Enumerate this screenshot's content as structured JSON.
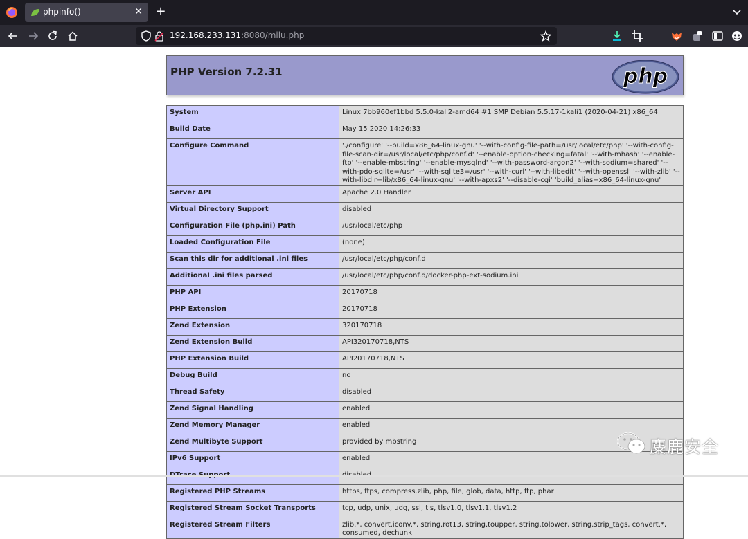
{
  "browser": {
    "tab_title": "phpinfo()",
    "tab_close": "✕",
    "new_tab": "+",
    "url_host": "192.168.233.131",
    "url_rest": ":8080/milu.php"
  },
  "page": {
    "heading": "PHP Version 7.2.31",
    "logo_text": "php",
    "rows": [
      {
        "k": "System",
        "v": "Linux 7bb960ef1bbd 5.5.0-kali2-amd64 #1 SMP Debian 5.5.17-1kali1 (2020-04-21) x86_64"
      },
      {
        "k": "Build Date",
        "v": "May 15 2020 14:26:33"
      },
      {
        "k": "Configure Command",
        "v": "'./configure' '--build=x86_64-linux-gnu' '--with-config-file-path=/usr/local/etc/php' '--with-config-file-scan-dir=/usr/local/etc/php/conf.d' '--enable-option-checking=fatal' '--with-mhash' '--enable-ftp' '--enable-mbstring' '--enable-mysqlnd' '--with-password-argon2' '--with-sodium=shared' '--with-pdo-sqlite=/usr' '--with-sqlite3=/usr' '--with-curl' '--with-libedit' '--with-openssl' '--with-zlib' '--with-libdir=lib/x86_64-linux-gnu' '--with-apxs2' '--disable-cgi' 'build_alias=x86_64-linux-gnu'"
      },
      {
        "k": "Server API",
        "v": "Apache 2.0 Handler"
      },
      {
        "k": "Virtual Directory Support",
        "v": "disabled"
      },
      {
        "k": "Configuration File (php.ini) Path",
        "v": "/usr/local/etc/php"
      },
      {
        "k": "Loaded Configuration File",
        "v": "(none)"
      },
      {
        "k": "Scan this dir for additional .ini files",
        "v": "/usr/local/etc/php/conf.d"
      },
      {
        "k": "Additional .ini files parsed",
        "v": "/usr/local/etc/php/conf.d/docker-php-ext-sodium.ini"
      },
      {
        "k": "PHP API",
        "v": "20170718"
      },
      {
        "k": "PHP Extension",
        "v": "20170718"
      },
      {
        "k": "Zend Extension",
        "v": "320170718"
      },
      {
        "k": "Zend Extension Build",
        "v": "API320170718,NTS"
      },
      {
        "k": "PHP Extension Build",
        "v": "API20170718,NTS"
      },
      {
        "k": "Debug Build",
        "v": "no"
      },
      {
        "k": "Thread Safety",
        "v": "disabled"
      },
      {
        "k": "Zend Signal Handling",
        "v": "enabled"
      },
      {
        "k": "Zend Memory Manager",
        "v": "enabled"
      },
      {
        "k": "Zend Multibyte Support",
        "v": "provided by mbstring"
      },
      {
        "k": "IPv6 Support",
        "v": "enabled"
      },
      {
        "k": "DTrace Support",
        "v": "disabled"
      },
      {
        "k": "Registered PHP Streams",
        "v": "https, ftps, compress.zlib, php, file, glob, data, http, ftp, phar"
      },
      {
        "k": "Registered Stream Socket Transports",
        "v": "tcp, udp, unix, udg, ssl, tls, tlsv1.0, tlsv1.1, tlsv1.2"
      },
      {
        "k": "Registered Stream Filters",
        "v": "zlib.*, convert.iconv.*, string.rot13, string.toupper, string.tolower, string.strip_tags, convert.*, consumed, dechunk"
      }
    ]
  },
  "watermark": {
    "text": "麋鹿安全"
  },
  "colors": {
    "header_bg": "#9999cc",
    "key_bg": "#ccccff",
    "value_bg": "#dddddd",
    "tabstrip_bg": "#1c1b22",
    "navbar_bg": "#2b2a33"
  },
  "icons": [
    "firefox-icon",
    "leaf-favicon-icon",
    "close-icon",
    "plus-icon",
    "chevron-down-icon",
    "back-icon",
    "forward-icon",
    "reload-icon",
    "home-icon",
    "shield-icon",
    "lock-insecure-icon",
    "star-icon",
    "download-icon",
    "crop-icon",
    "fox-extension-icon",
    "puzzle-extension-icon",
    "sidebar-icon",
    "ghost-extension-icon",
    "wechat-icon"
  ]
}
